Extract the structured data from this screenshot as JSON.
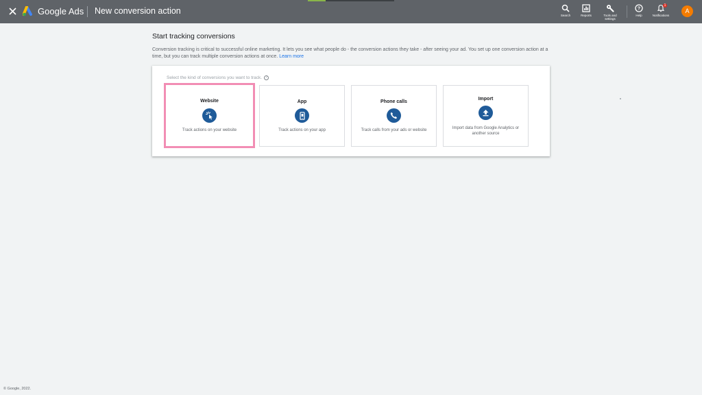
{
  "header": {
    "brand": "Google Ads",
    "title": "New conversion action",
    "tools": [
      {
        "label": "Search",
        "icon": "search-icon"
      },
      {
        "label": "Reports",
        "icon": "reports-icon"
      },
      {
        "label": "Tools and settings",
        "icon": "wrench-icon"
      },
      {
        "label": "Help",
        "icon": "help-icon"
      },
      {
        "label": "Notifications",
        "icon": "bell-icon",
        "badge": "1"
      }
    ],
    "avatar": "A"
  },
  "main": {
    "heading": "Start tracking conversions",
    "intro": "Conversion tracking is critical to successful online marketing. It lets you see what people do - the conversion actions they take - after seeing your ad. You set up one conversion action at a time, but you can track multiple conversion actions at once.",
    "learn_more": "Learn more",
    "prompt": "Select the kind of conversions you want to track.",
    "cards": [
      {
        "title": "Website",
        "description": "Track actions on your website",
        "icon": "cursor-click-icon",
        "selected": true
      },
      {
        "title": "App",
        "description": "Track actions on your app",
        "icon": "phone-app-icon",
        "selected": false
      },
      {
        "title": "Phone calls",
        "description": "Track calls from your ads or website",
        "icon": "phone-call-icon",
        "selected": false
      },
      {
        "title": "Import",
        "description": "Import data from Google Analytics or another source",
        "icon": "upload-icon",
        "selected": false
      }
    ]
  },
  "footer": "© Google, 2022.",
  "colors": {
    "topbar": "#5f6368",
    "background": "#f1f3f4",
    "icon_circle": "#1f5b99",
    "selected_border": "#f28db4",
    "link": "#1a73e8",
    "avatar": "#f57c00"
  }
}
